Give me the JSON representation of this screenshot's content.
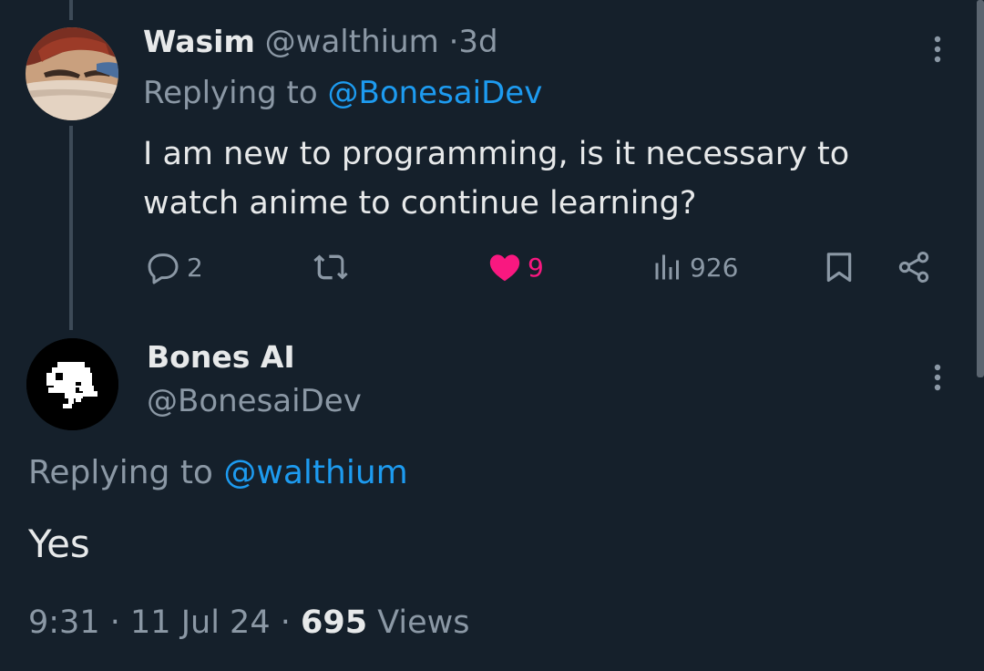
{
  "reply_tweet": {
    "author_name": "Wasim",
    "author_handle": "@walthium",
    "separator": "·",
    "time_ago": "3d",
    "replying_to_label": "Replying to",
    "replying_to_handle": "@BonesaiDev",
    "text": "I am new to programming, is it necessary to watch anime to continue learning?",
    "reply_count": "2",
    "like_count": "9",
    "view_count": "926",
    "icons": [
      "reply-icon",
      "retweet-icon",
      "like-icon-filled",
      "views-icon",
      "bookmark-icon",
      "share-icon",
      "more-icon"
    ]
  },
  "main_tweet": {
    "author_name": "Bones AI",
    "author_handle": "@BonesaiDev",
    "replying_to_label": "Replying to",
    "replying_to_handle": "@walthium",
    "text": "Yes",
    "time": "9:31",
    "separator": "·",
    "date": "11 Jul 24",
    "views_count": "695",
    "views_label": "Views"
  },
  "colors": {
    "background": "#15202b",
    "text": "#e7e9ea",
    "muted": "#8b98a5",
    "link": "#1d9bf0",
    "like": "#f91880",
    "thread_line": "#3d4a57"
  }
}
